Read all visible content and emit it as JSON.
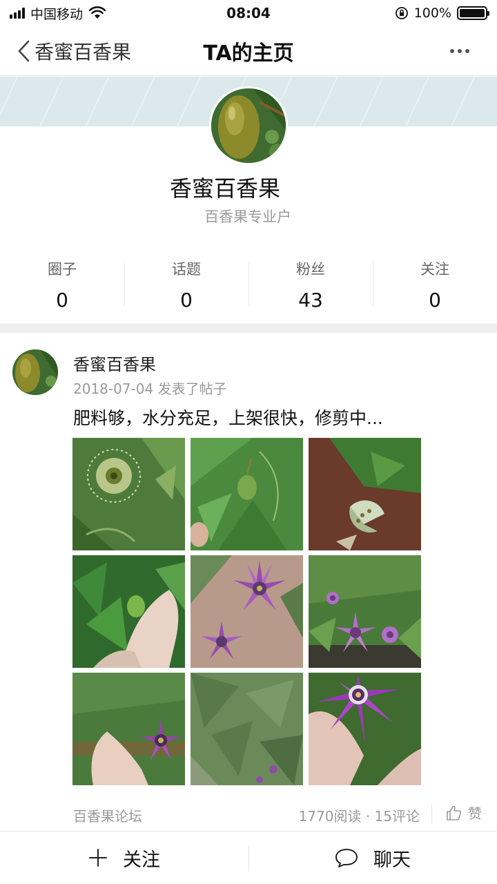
{
  "status_bar": {
    "carrier": "中国移动",
    "time": "08:04",
    "battery": "100%",
    "battery_level": 1.0
  },
  "nav": {
    "back_label": "香蜜百香果",
    "title": "TA的主页"
  },
  "profile": {
    "name": "香蜜百香果",
    "subtitle": "百香果专业户",
    "stats": [
      {
        "label": "圈子",
        "value": "0"
      },
      {
        "label": "话题",
        "value": "0"
      },
      {
        "label": "粉丝",
        "value": "43"
      },
      {
        "label": "关注",
        "value": "0"
      }
    ]
  },
  "post": {
    "author": "香蜜百香果",
    "meta": "2018-07-04 发表了帖子",
    "text": "肥料够，水分充足，上架很快，修剪中...",
    "photos": [
      "flower-green-photo",
      "fruit-vine-photo",
      "cut-fruit-photo",
      "hand-fruit-photo",
      "purple-flower-photo",
      "purple-flower-vine-photo",
      "hand-flower-photo",
      "vine-leaves-photo",
      "purple-flower-closeup-photo"
    ],
    "forum": "百香果论坛",
    "reads": "1770阅读 · 15评论",
    "like_label": "赞"
  },
  "bottom_bar": {
    "follow_label": "关注",
    "chat_label": "聊天"
  },
  "icons": {
    "back": "chevron-left-icon",
    "more": "more-dots-icon",
    "like": "thumbs-up-icon",
    "follow": "plus-icon",
    "chat": "chat-bubble-icon"
  }
}
